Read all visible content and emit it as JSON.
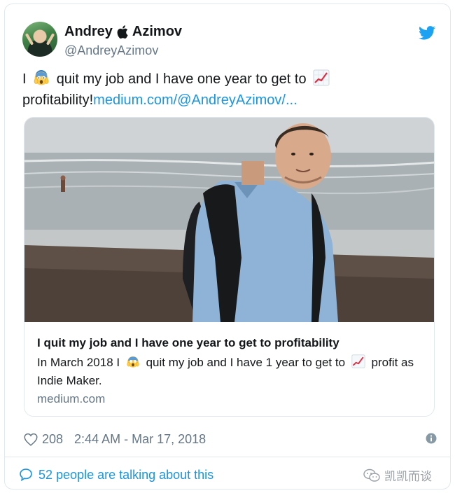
{
  "tweet": {
    "author": {
      "first_name": "Andrey",
      "last_name": "Azimov",
      "handle": "@AndreyAzimov"
    },
    "text": {
      "part1": "I",
      "part2": "quit my job and I have one year to get to",
      "part3": "profitability!",
      "link": "medium.com/@AndreyAzimov/..."
    },
    "card": {
      "title": "I quit my job and I have one year to get to profitability",
      "desc_part1": "In March 2018 I",
      "desc_part2": "quit my job and I have 1 year to get to",
      "desc_part3": "profit as Indie Maker.",
      "domain": "medium.com"
    },
    "likes": "208",
    "timestamp": "2:44 AM - Mar 17, 2018",
    "conversation": "52 people are talking about this"
  },
  "watermark": "凯凯而谈",
  "icons": [
    "apple-icon",
    "twitter-bird-icon",
    "scream-emoji-icon",
    "chart-increasing-emoji-icon",
    "heart-icon",
    "info-icon",
    "chat-bubble-icon",
    "wechat-icon"
  ],
  "colors": {
    "link": "#1b95e0",
    "muted": "#657786",
    "border": "#e1e8ed",
    "text": "#14171a"
  }
}
